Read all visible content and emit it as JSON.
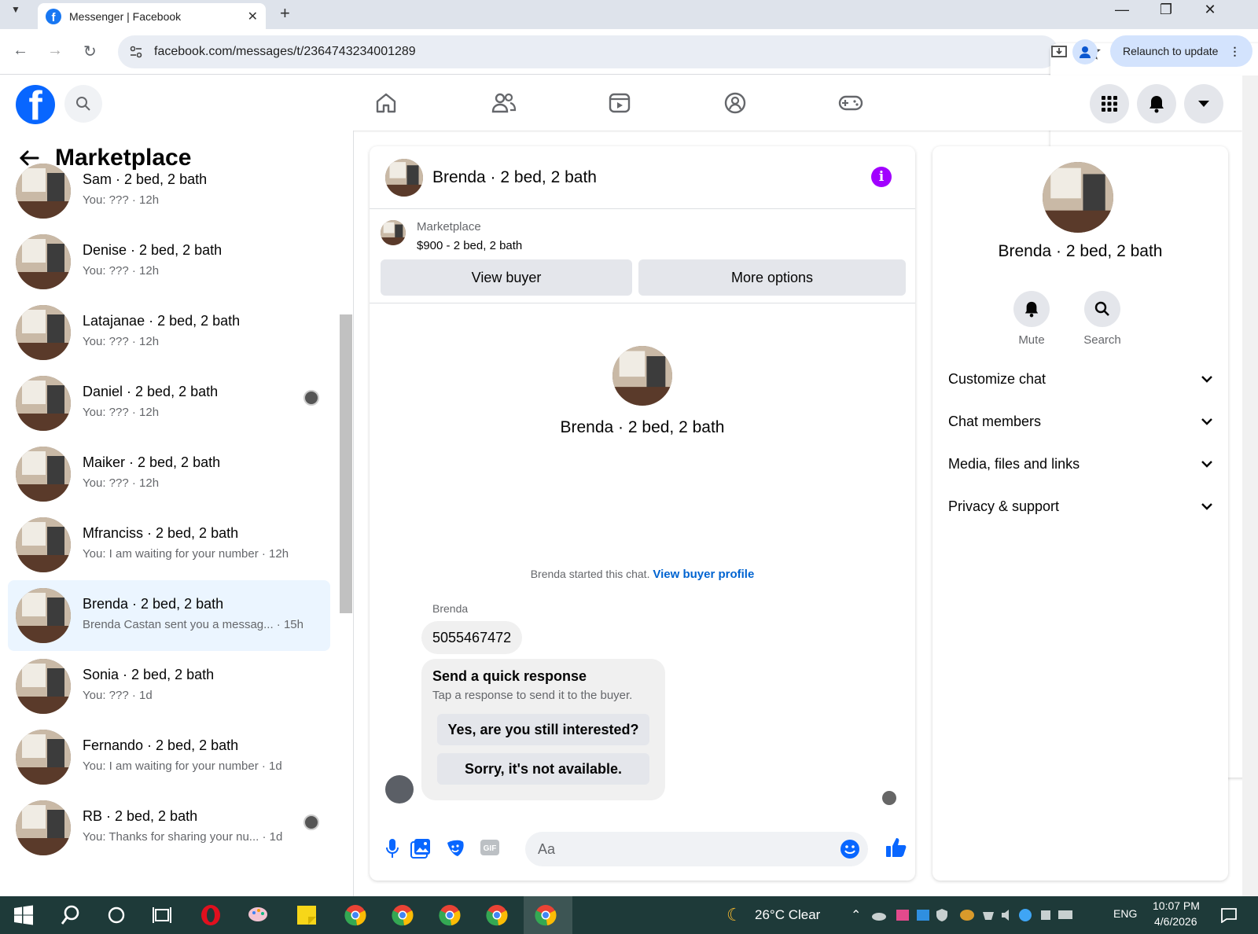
{
  "browser": {
    "tab_title": "Messenger | Facebook",
    "url": "facebook.com/messages/t/2364743234001289",
    "relaunch_label": "Relaunch to update"
  },
  "left_panel": {
    "title": "Marketplace",
    "conversations": [
      {
        "name": "Sam · 2 bed, 2 bath",
        "preview": "You: ??? · 12h"
      },
      {
        "name": "Denise · 2 bed, 2 bath",
        "preview": "You: ??? · 12h"
      },
      {
        "name": "Latajanae · 2 bed, 2 bath",
        "preview": "You: ??? · 12h"
      },
      {
        "name": "Daniel · 2 bed, 2 bath",
        "preview": "You: ??? · 12h"
      },
      {
        "name": "Maiker · 2 bed, 2 bath",
        "preview": "You: ??? · 12h"
      },
      {
        "name": "Mfranciss · 2 bed, 2 bath",
        "preview": "You: I am waiting for your number · 12h"
      },
      {
        "name": "Brenda · 2 bed, 2 bath",
        "preview": "Brenda Castan sent you a messag... · 15h"
      },
      {
        "name": "Sonia · 2 bed, 2 bath",
        "preview": "You: ??? · 1d"
      },
      {
        "name": "Fernando · 2 bed, 2 bath",
        "preview": "You: I am waiting for your number · 1d"
      },
      {
        "name": "RB · 2 bed, 2 bath",
        "preview": "You: Thanks for sharing your nu... · 1d"
      }
    ]
  },
  "chat": {
    "name": "Brenda · 2 bed, 2 bath",
    "marketplace_label": "Marketplace",
    "listing": "$900 - 2 bed, 2 bath",
    "view_buyer": "View buyer",
    "more_options": "More options",
    "started_text": "Brenda started this chat.",
    "view_profile": "View buyer profile",
    "sender": "Brenda",
    "message": "5055467472",
    "quick_title": "Send a quick response",
    "quick_sub": "Tap a response to send it to the buyer.",
    "option1": "Yes, are you still interested?",
    "option2": "Sorry, it's not available.",
    "input_placeholder": "Aa"
  },
  "right_panel": {
    "name": "Brenda · 2 bed, 2 bath",
    "mute": "Mute",
    "search": "Search",
    "sections": [
      "Customize chat",
      "Chat members",
      "Media, files and links",
      "Privacy & support"
    ]
  },
  "taskbar": {
    "weather": "26°C  Clear",
    "lang": "ENG",
    "time": "10:07 PM",
    "date": "4/6/2026"
  },
  "colors": {
    "brand": "#0866ff",
    "info": "#a100ff",
    "active_row": "#ebf5ff"
  }
}
